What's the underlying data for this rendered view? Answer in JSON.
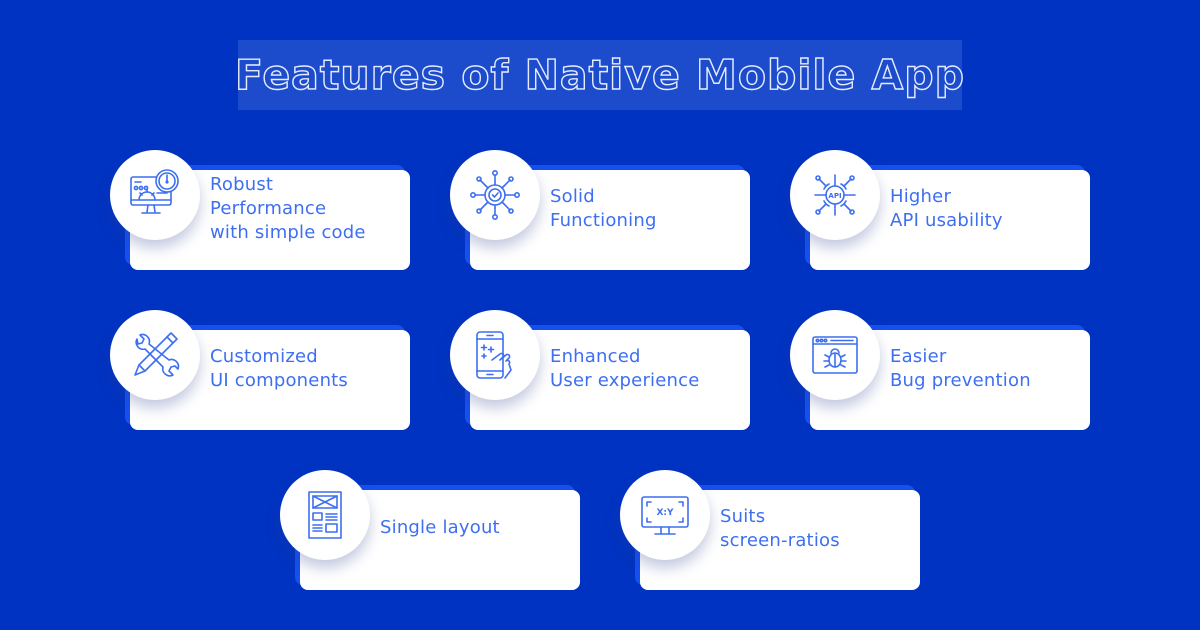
{
  "title": "Features of Native Mobile App",
  "colors": {
    "background": "#0033c2",
    "title_box": "#1c4ccb",
    "card_back": "#1750f0",
    "card": "#ffffff",
    "accent_text": "#3d6ff0"
  },
  "features": [
    {
      "icon": "monitor-speedometer-icon",
      "lines": [
        "Robust",
        "Performance",
        "with simple code"
      ]
    },
    {
      "icon": "network-gear-check-icon",
      "lines": [
        "Solid",
        "Functioning"
      ]
    },
    {
      "icon": "api-gear-icon",
      "lines": [
        "Higher",
        "API usability"
      ]
    },
    {
      "icon": "wrench-pencil-icon",
      "lines": [
        "Customized",
        "UI components"
      ]
    },
    {
      "icon": "smartphone-touch-icon",
      "lines": [
        "Enhanced",
        "User experience"
      ]
    },
    {
      "icon": "browser-bug-icon",
      "lines": [
        "Easier",
        "Bug prevention"
      ]
    },
    {
      "icon": "layout-wireframe-icon",
      "lines": [
        "Single layout"
      ]
    },
    {
      "icon": "monitor-aspect-ratio-icon",
      "lines": [
        "Suits",
        "screen-ratios"
      ],
      "icon_text": "X:Y"
    }
  ]
}
